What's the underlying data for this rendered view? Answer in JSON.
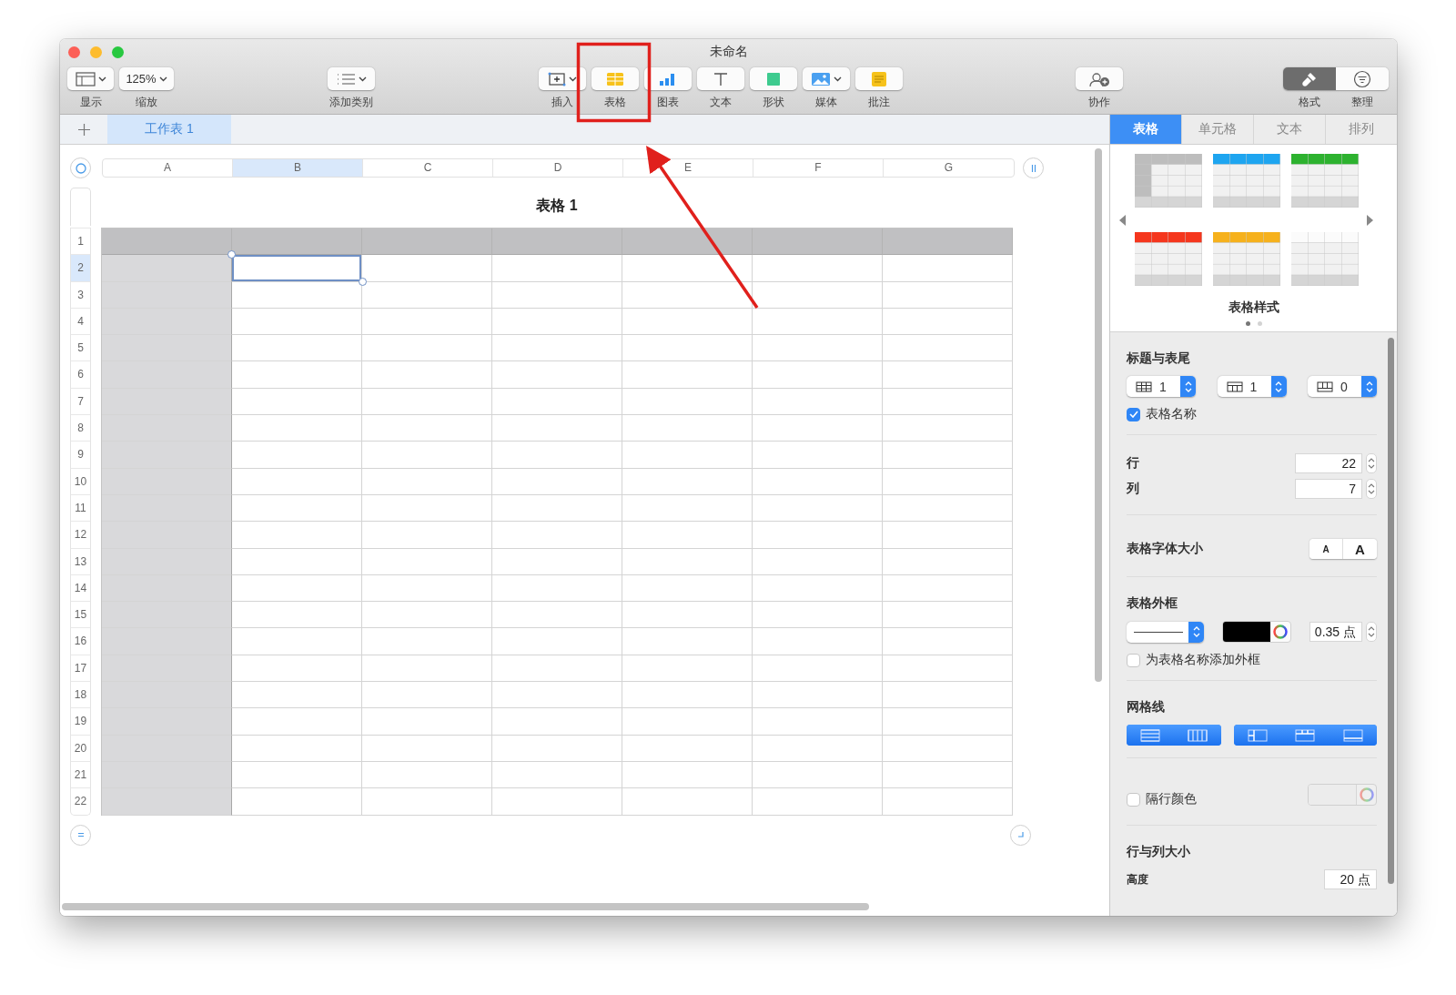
{
  "window": {
    "title": "未命名"
  },
  "toolbar": {
    "left": [
      {
        "kind": "view",
        "label": "显示"
      },
      {
        "kind": "zoom",
        "value": "125%",
        "label": "缩放"
      }
    ],
    "middle": [
      {
        "kind": "category",
        "label": "添加类别"
      }
    ],
    "insert": [
      {
        "kind": "insert",
        "label": "插入"
      },
      {
        "kind": "table",
        "label": "表格"
      },
      {
        "kind": "chart",
        "label": "图表"
      },
      {
        "kind": "text",
        "label": "文本"
      },
      {
        "kind": "shape",
        "label": "形状"
      },
      {
        "kind": "media",
        "label": "媒体"
      },
      {
        "kind": "comment",
        "label": "批注"
      }
    ],
    "share": [
      {
        "kind": "collaborate",
        "label": "协作"
      }
    ],
    "inspector": [
      {
        "kind": "format",
        "label": "格式",
        "selected": true
      },
      {
        "kind": "organize",
        "label": "整理",
        "selected": false
      }
    ]
  },
  "sheet_tabs": [
    {
      "label": "工作表 1",
      "selected": true
    }
  ],
  "table": {
    "title": "表格 1",
    "columns": [
      {
        "label": "A",
        "selected": false
      },
      {
        "label": "B",
        "selected": true
      },
      {
        "label": "C",
        "selected": false
      },
      {
        "label": "D",
        "selected": false
      },
      {
        "label": "E",
        "selected": false
      },
      {
        "label": "F",
        "selected": false
      },
      {
        "label": "G",
        "selected": false
      }
    ],
    "rows": [
      {
        "label": "1",
        "selected": false
      },
      {
        "label": "2",
        "selected": true
      },
      {
        "label": "3",
        "selected": false
      },
      {
        "label": "4",
        "selected": false
      },
      {
        "label": "5",
        "selected": false
      },
      {
        "label": "6",
        "selected": false
      },
      {
        "label": "7",
        "selected": false
      },
      {
        "label": "8",
        "selected": false
      },
      {
        "label": "9",
        "selected": false
      },
      {
        "label": "10",
        "selected": false
      },
      {
        "label": "11",
        "selected": false
      },
      {
        "label": "12",
        "selected": false
      },
      {
        "label": "13",
        "selected": false
      },
      {
        "label": "14",
        "selected": false
      },
      {
        "label": "15",
        "selected": false
      },
      {
        "label": "16",
        "selected": false
      },
      {
        "label": "17",
        "selected": false
      },
      {
        "label": "18",
        "selected": false
      },
      {
        "label": "19",
        "selected": false
      },
      {
        "label": "20",
        "selected": false
      },
      {
        "label": "21",
        "selected": false
      },
      {
        "label": "22",
        "selected": false
      }
    ]
  },
  "inspector": {
    "tabs": [
      {
        "label": "表格",
        "selected": true
      },
      {
        "label": "单元格",
        "selected": false
      },
      {
        "label": "文本",
        "selected": false
      },
      {
        "label": "排列",
        "selected": false
      }
    ],
    "table_styles": {
      "styles": [
        {
          "kind": "row_column",
          "color": "#bdbdbd"
        },
        {
          "kind": "row",
          "color": "#1ea5f0"
        },
        {
          "kind": "row",
          "color": "#2db22f"
        },
        {
          "kind": "row",
          "color": "#f5361d"
        },
        {
          "kind": "row",
          "color": "#f6b11c"
        },
        {
          "kind": "row",
          "color": "#fbfbfb"
        }
      ],
      "label": "表格样式",
      "pages": [
        {
          "selected": true
        },
        {
          "selected": false
        }
      ]
    },
    "headers": {
      "title": "标题与表尾",
      "steppers": [
        {
          "kind": "header_rows",
          "value": "1"
        },
        {
          "kind": "header_columns",
          "value": "1"
        },
        {
          "kind": "footer_rows",
          "value": "0"
        }
      ],
      "table_name": {
        "label": "表格名称",
        "checked": true
      }
    },
    "size_fields": [
      {
        "label": "行",
        "value": "22"
      },
      {
        "label": "列",
        "value": "7"
      }
    ],
    "font_size": {
      "label": "表格字体大小",
      "buttons": [
        {
          "kind": "smaller",
          "label": "A"
        },
        {
          "kind": "larger",
          "label": "A"
        }
      ]
    },
    "outline": {
      "title": "表格外框",
      "color": "#000000",
      "width": "0.35 点",
      "name_outline": {
        "label": "为表格名称添加外框",
        "checked": false
      }
    },
    "gridlines": {
      "title": "网格线",
      "groups": [
        {
          "buttons": [
            {
              "kind": "horizontal",
              "on": true
            },
            {
              "kind": "vertical",
              "on": true
            }
          ]
        },
        {
          "buttons": [
            {
              "kind": "header_column",
              "on": true
            },
            {
              "kind": "header_row",
              "on": true
            },
            {
              "kind": "footer",
              "on": true
            }
          ]
        }
      ]
    },
    "alternating": {
      "label": "隔行颜色",
      "checked": false
    },
    "row_column_size": {
      "title": "行与列大小",
      "fields": [
        {
          "label": "高度",
          "value": "20 点"
        }
      ]
    }
  },
  "annotation": {
    "kind": "box_and_arrow",
    "color": "#e0201c"
  }
}
